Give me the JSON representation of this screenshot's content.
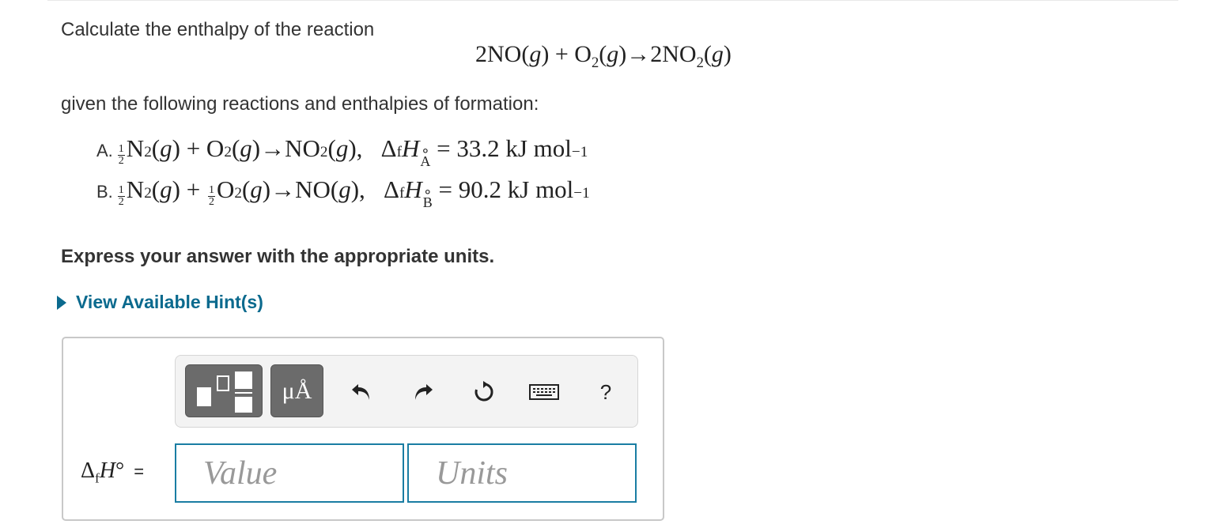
{
  "question": {
    "intro": "Calculate the enthalpy of the reaction",
    "reaction": {
      "lhs_coef": "2",
      "lhs_species": "NO",
      "phase": "g",
      "o2_base": "O",
      "o2_sub": "2",
      "rhs_coef": "2",
      "rhs_base": "NO",
      "rhs_sub": "2"
    },
    "given": "given the following reactions and enthalpies of formation:",
    "reactions": [
      {
        "letter": "A.",
        "enthalpy_label": "A",
        "value": "33.2",
        "unit": "kJ mol",
        "unit_exp": "−1"
      },
      {
        "letter": "B.",
        "enthalpy_label": "B",
        "value": "90.2",
        "unit": "kJ mol",
        "unit_exp": "−1"
      }
    ],
    "express": "Express your answer with the appropriate units.",
    "hints_label": "View Available Hint(s)"
  },
  "toolbar": {
    "units_button_label": "μÅ",
    "help_label": "?",
    "icons": [
      "templates-icon",
      "units-icon",
      "undo-icon",
      "redo-icon",
      "reset-icon",
      "keyboard-icon",
      "help-icon"
    ]
  },
  "answer": {
    "label_symbol": "ΔfH°",
    "equals": "=",
    "value_placeholder": "Value",
    "units_placeholder": "Units"
  },
  "colors": {
    "link": "#0b6a8e",
    "input_border": "#1a7da3",
    "button_dark": "#6b6b6b"
  }
}
